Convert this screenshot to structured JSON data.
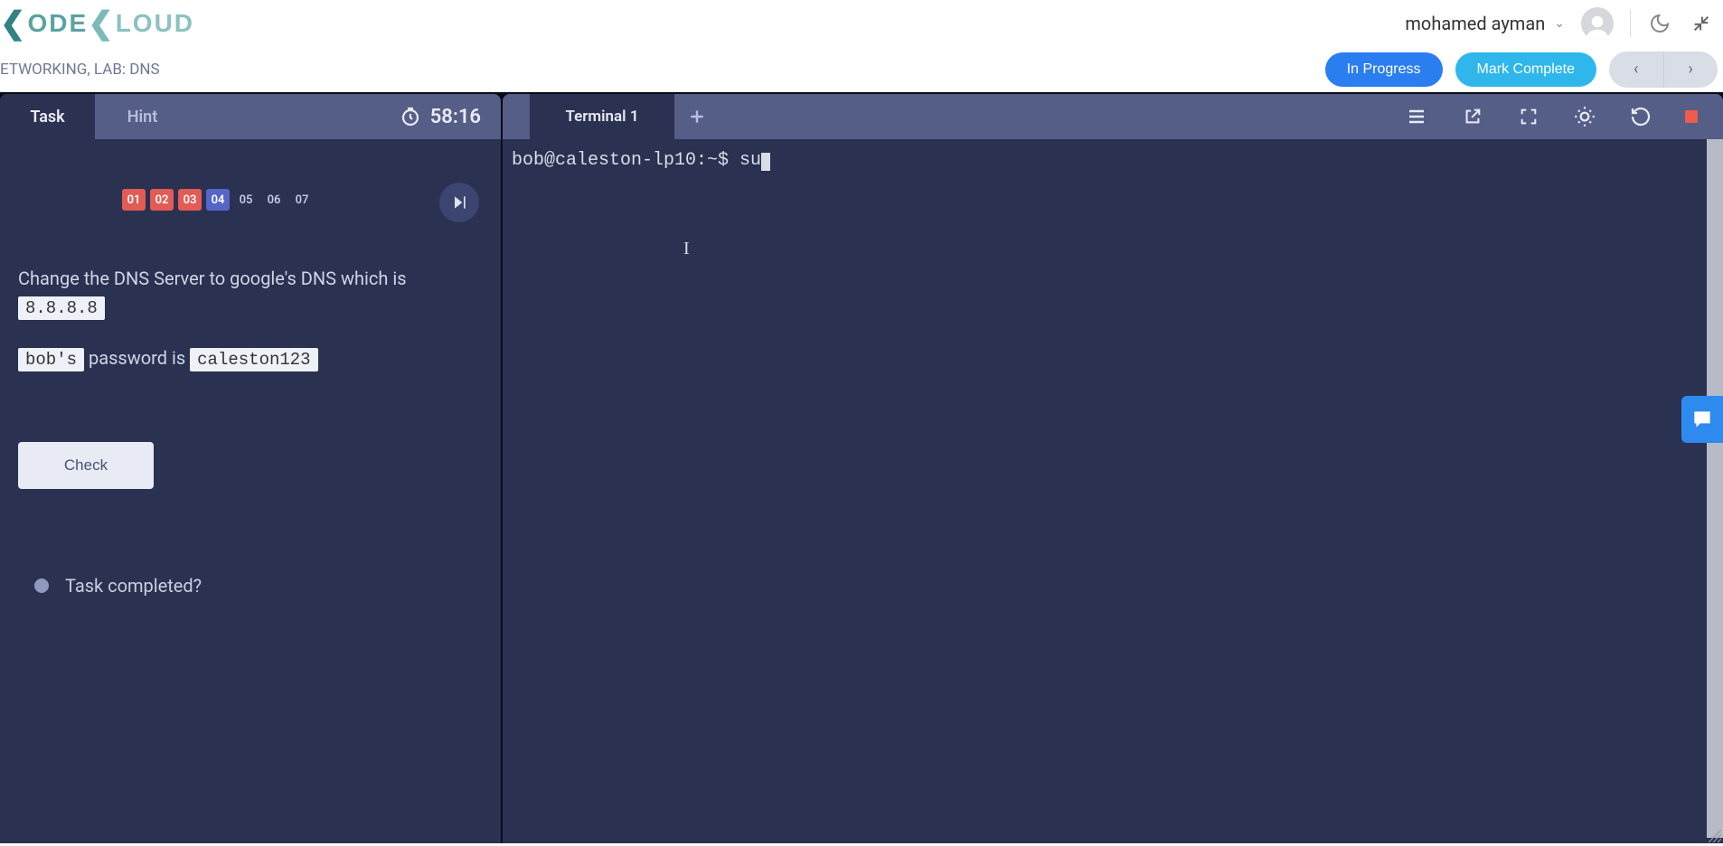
{
  "header": {
    "logo_text": "KODEKLOUD",
    "user_name": "mohamed ayman"
  },
  "subbar": {
    "breadcrumb": "ETWORKING, LAB: DNS",
    "in_progress": "In Progress",
    "mark_complete": "Mark Complete"
  },
  "task_panel": {
    "tab_task": "Task",
    "tab_hint": "Hint",
    "timer": "58:16",
    "steps": [
      "01",
      "02",
      "03",
      "04",
      "05",
      "06",
      "07"
    ],
    "instruction_pre": "Change the DNS Server to google's DNS which is ",
    "instruction_code": "8.8.8.8",
    "hint_user_code": "bob's",
    "hint_mid": " password is ",
    "hint_pwd_code": "caleston123",
    "check_label": "Check",
    "completed_label": "Task completed?"
  },
  "terminal": {
    "tab_label": "Terminal 1",
    "prompt": "bob@caleston-lp10:~$ ",
    "command": "su"
  }
}
